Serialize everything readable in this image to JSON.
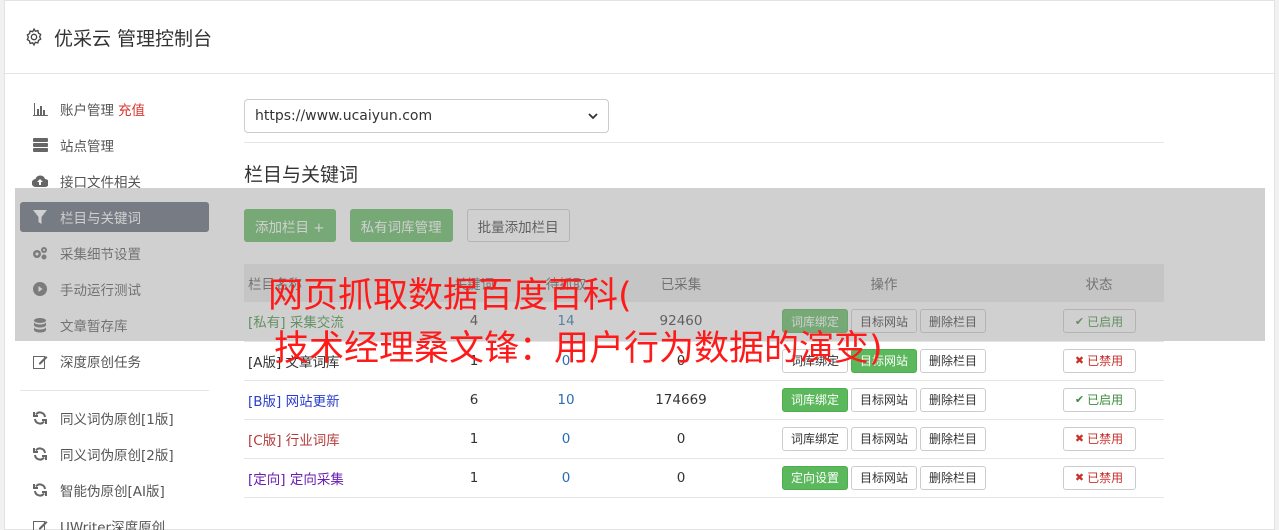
{
  "header": {
    "title": "优采云 管理控制台",
    "icon": "gear-icon"
  },
  "sidebar": {
    "items": [
      {
        "label": "账户管理",
        "extra": "充值",
        "icon": "bar-chart-icon",
        "active": false
      },
      {
        "label": "站点管理",
        "icon": "server-icon",
        "active": false
      },
      {
        "label": "接口文件相关",
        "icon": "cloud-upload-icon",
        "active": false
      },
      {
        "label": "栏目与关键词",
        "icon": "filter-icon",
        "active": true
      },
      {
        "label": "采集细节设置",
        "icon": "cogs-icon",
        "active": false
      },
      {
        "label": "手动运行测试",
        "icon": "play-circle-icon",
        "active": false
      },
      {
        "label": "文章暂存库",
        "icon": "database-icon",
        "active": false
      },
      {
        "label": "深度原创任务",
        "icon": "edit-icon",
        "active": false
      }
    ],
    "items2": [
      {
        "label": "同义词伪原创[1版]",
        "icon": "refresh-icon"
      },
      {
        "label": "同义词伪原创[2版]",
        "icon": "refresh-icon"
      },
      {
        "label": "智能伪原创[AI版]",
        "icon": "refresh-icon"
      },
      {
        "label": "UWriter深度原创",
        "icon": "edit-icon"
      }
    ]
  },
  "main": {
    "site_select": {
      "value": "https://www.ucaiyun.com"
    },
    "section_title": "栏目与关键词",
    "buttons": {
      "add": "添加栏目 +",
      "private_lib": "私有词库管理",
      "batch_add": "批量添加栏目"
    },
    "table": {
      "headers": [
        "栏目名称",
        "关键词",
        "待抓取",
        "已采集",
        "操作",
        "状态"
      ],
      "rows": [
        {
          "name": "[私有] 采集交流",
          "a": "4",
          "b": "14",
          "c": "92460",
          "ops": [
            "词库绑定",
            "目标网站",
            "删除栏目"
          ],
          "op1_green": true,
          "status": "已启用",
          "on": true
        },
        {
          "name": "[A版] 文章词库",
          "a": "1",
          "b": "0",
          "c": "0",
          "ops": [
            "词库绑定",
            "目标网站",
            "删除栏目"
          ],
          "op1_green": false,
          "status": "已禁用",
          "on": false
        },
        {
          "name": "[B版] 网站更新",
          "a": "6",
          "b": "10",
          "c": "174669",
          "ops": [
            "词库绑定",
            "目标网站",
            "删除栏目"
          ],
          "op1_green": true,
          "status": "已启用",
          "on": true
        },
        {
          "name": "[C版] 行业词库",
          "a": "1",
          "b": "0",
          "c": "0",
          "ops": [
            "词库绑定",
            "目标网站",
            "删除栏目"
          ],
          "op1_green": false,
          "status": "已禁用",
          "on": false
        },
        {
          "name": "[定向] 定向采集",
          "a": "1",
          "b": "0",
          "c": "0",
          "ops": [
            "定向设置",
            "目标网站",
            "删除栏目"
          ],
          "op1_green": true,
          "status": "已禁用",
          "on": false
        }
      ]
    }
  },
  "overlay": {
    "line1": "网页抓取数据百度百科(",
    "line2": "技术经理桑文锋：用户行为数据的演变)"
  },
  "colors": {
    "active_nav": "#5d6576",
    "green": "#5cb85c",
    "red": "#c9302c",
    "overlay_text": "#ff1a1a"
  }
}
